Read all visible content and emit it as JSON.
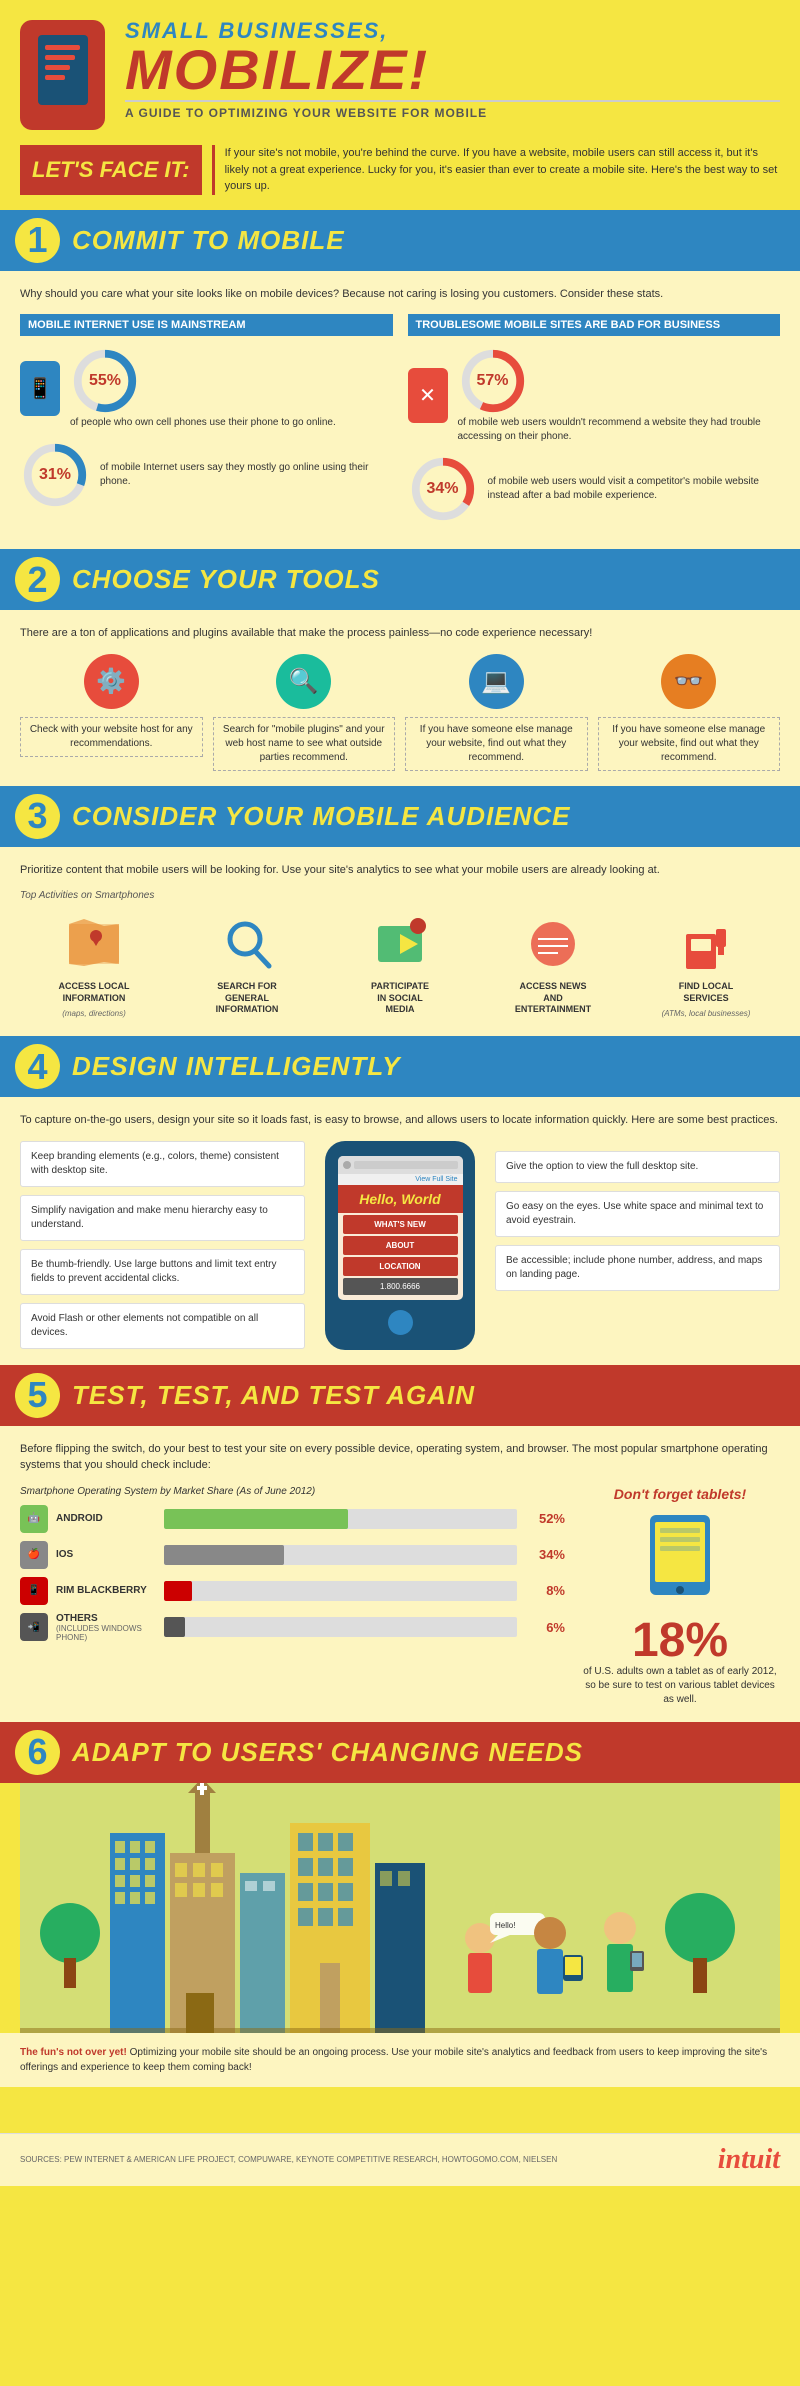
{
  "header": {
    "title_small": "Small Businesses,",
    "title_big": "MOBILIZE!",
    "subtitle": "A Guide to Optimizing Your Website for Mobile",
    "lets_face_it": "LET'S FACE IT:",
    "intro_text": "If your site's not mobile, you're behind the curve. If you have a website, mobile users can still access it, but it's likely not a great experience. Lucky for you, it's easier than ever to create a mobile site. Here's the best way to set yours up."
  },
  "sections": {
    "s1": {
      "number": "1",
      "title": "COMMIT TO MOBILE",
      "intro": "Why should you care what your site looks like on mobile devices? Because not caring is losing you customers. Consider these stats.",
      "col1_title": "MOBILE INTERNET USE IS MAINSTREAM",
      "col2_title": "TROUBLESOME MOBILE SITES ARE BAD FOR BUSINESS",
      "stat1_pct": "55%",
      "stat1_text": "of people who own cell phones use their phone to go online.",
      "stat2_pct": "31%",
      "stat2_text": "of mobile Internet users say they mostly go online using their phone.",
      "stat3_pct": "57%",
      "stat3_text": "of mobile web users wouldn't recommend a website they had trouble accessing on their phone.",
      "stat4_pct": "34%",
      "stat4_text": "of mobile web users would visit a competitor's mobile website instead after a bad mobile experience."
    },
    "s2": {
      "number": "2",
      "title": "CHOOSE YOUR TOOLS",
      "intro": "There are a ton of applications and plugins available that make the process painless—no code experience necessary!",
      "tool1_text": "Check with your website host for any recommendations.",
      "tool2_text": "Search for \"mobile plugins\" and your web host name to see what outside parties recommend.",
      "tool3_text": "If you have someone else manage your website, find out what they recommend."
    },
    "s3": {
      "number": "3",
      "title": "CONSIDER YOUR MOBILE AUDIENCE",
      "intro": "Prioritize content that mobile users will be looking for. Use your site's analytics to see what your mobile users are already looking at.",
      "activities_title": "Top Activities on Smartphones",
      "activities": [
        {
          "label": "ACCESS LOCAL\nINFORMATION",
          "sublabel": "(maps, directions)",
          "icon": "📍"
        },
        {
          "label": "SEARCH FOR\nGENERAL\nINFORMATION",
          "sublabel": "",
          "icon": "🔍"
        },
        {
          "label": "PARTICIPATE\nIN SOCIAL\nMEDIA",
          "sublabel": "",
          "icon": "🎬"
        },
        {
          "label": "ACCESS NEWS\nAND\nENTERTAINMENT",
          "sublabel": "",
          "icon": "🎭"
        },
        {
          "label": "FIND LOCAL\nSERVICES",
          "sublabel": "(ATMs, local businesses)",
          "icon": "⛽"
        }
      ]
    },
    "s4": {
      "number": "4",
      "title": "DESIGN INTELLIGENTLY",
      "intro": "To capture on-the-go users, design your site so it loads fast, is easy to browse, and allows users to locate information quickly. Here are some best practices.",
      "tips_left": [
        "Keep branding elements (e.g., colors, theme) consistent with desktop site.",
        "Simplify navigation and make menu hierarchy easy to understand.",
        "Be thumb-friendly. Use large buttons and limit text entry fields to prevent accidental clicks.",
        "Avoid Flash or other elements not compatible on all devices."
      ],
      "tips_right": [
        "Give the option to view the full desktop site.",
        "Go easy on the eyes. Use white space and minimal text to avoid eyestrain.",
        "Be accessible; include phone number, address, and maps on landing page."
      ],
      "phone_hello": "Hello, World",
      "phone_whats_new": "WHAT'S NEW",
      "phone_about": "ABOUT",
      "phone_location": "LOCATION",
      "phone_number": "1.800.6666",
      "phone_view_full": "View Full Site"
    },
    "s5": {
      "number": "5",
      "title": "TEST, TEST, AND TEST AGAIN",
      "intro": "Before flipping the switch, do your best to test your site on every possible device, operating system, and browser. The most popular smartphone operating systems that you should check include:",
      "chart_title": "Smartphone Operating System by Market Share (As of June 2012)",
      "os": [
        {
          "name": "ANDROID",
          "pct": 52,
          "pct_label": "52%",
          "color": "#78c257"
        },
        {
          "name": "iOS",
          "pct": 34,
          "pct_label": "34%",
          "color": "#888888"
        },
        {
          "name": "RIM BLACKBERRY",
          "pct": 8,
          "pct_label": "8%",
          "color": "#cc0000"
        },
        {
          "name": "OTHERS",
          "sub": "(includes Windows Phone)",
          "pct": 6,
          "pct_label": "6%",
          "color": "#555555"
        }
      ],
      "tablet_title": "Don't forget tablets!",
      "tablet_pct": "18%",
      "tablet_text": "of U.S. adults own a tablet as of early 2012, so be sure to test on various tablet devices as well."
    },
    "s6": {
      "number": "6",
      "title": "ADAPT TO USERS' CHANGING NEEDS",
      "footer_text": "The fun's not over yet! Optimizing your mobile site should be an ongoing process. Use your mobile site's analytics and feedback from users to keep improving the site's offerings and experience to keep them coming back!"
    }
  },
  "footer": {
    "sources": "SOURCES: PEW INTERNET & AMERICAN LIFE PROJECT, COMPUWARE, KEYNOTE\nCOMPETITIVE RESEARCH, HOWTOGOMO.COM, NIELSEN",
    "brand": "intuit"
  }
}
